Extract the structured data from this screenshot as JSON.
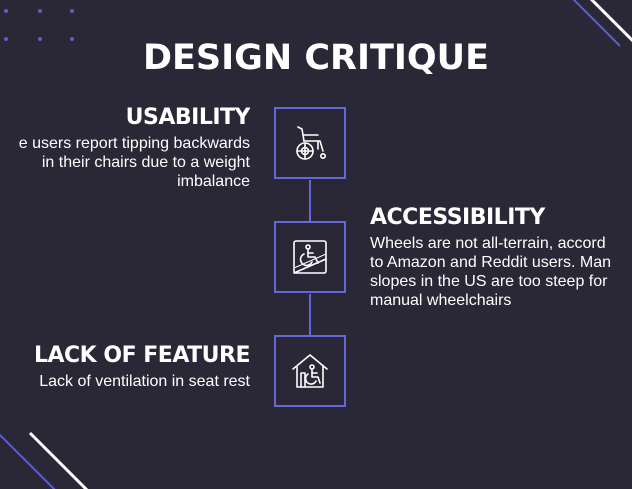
{
  "title": "DESIGN CRITIQUE",
  "sections": [
    {
      "heading": "USABILITY",
      "lines": [
        "e users report tipping backwards",
        "in their chairs due to a weight",
        "imbalance"
      ],
      "icon": "wheelchair-icon"
    },
    {
      "heading": "ACCESSIBILITY",
      "lines": [
        "Wheels are not all-terrain, accord",
        "to Amazon and Reddit users. Man",
        "slopes in the US are too steep for",
        "manual wheelchairs"
      ],
      "icon": "wheelchair-ramp-icon"
    },
    {
      "heading": "LACK OF FEATURE",
      "lines": [
        "Lack of ventilation in seat rest"
      ],
      "icon": "wheelchair-house-icon"
    }
  ],
  "colors": {
    "background": "#2a2736",
    "accent": "#6468d8",
    "text": "#ffffff"
  }
}
